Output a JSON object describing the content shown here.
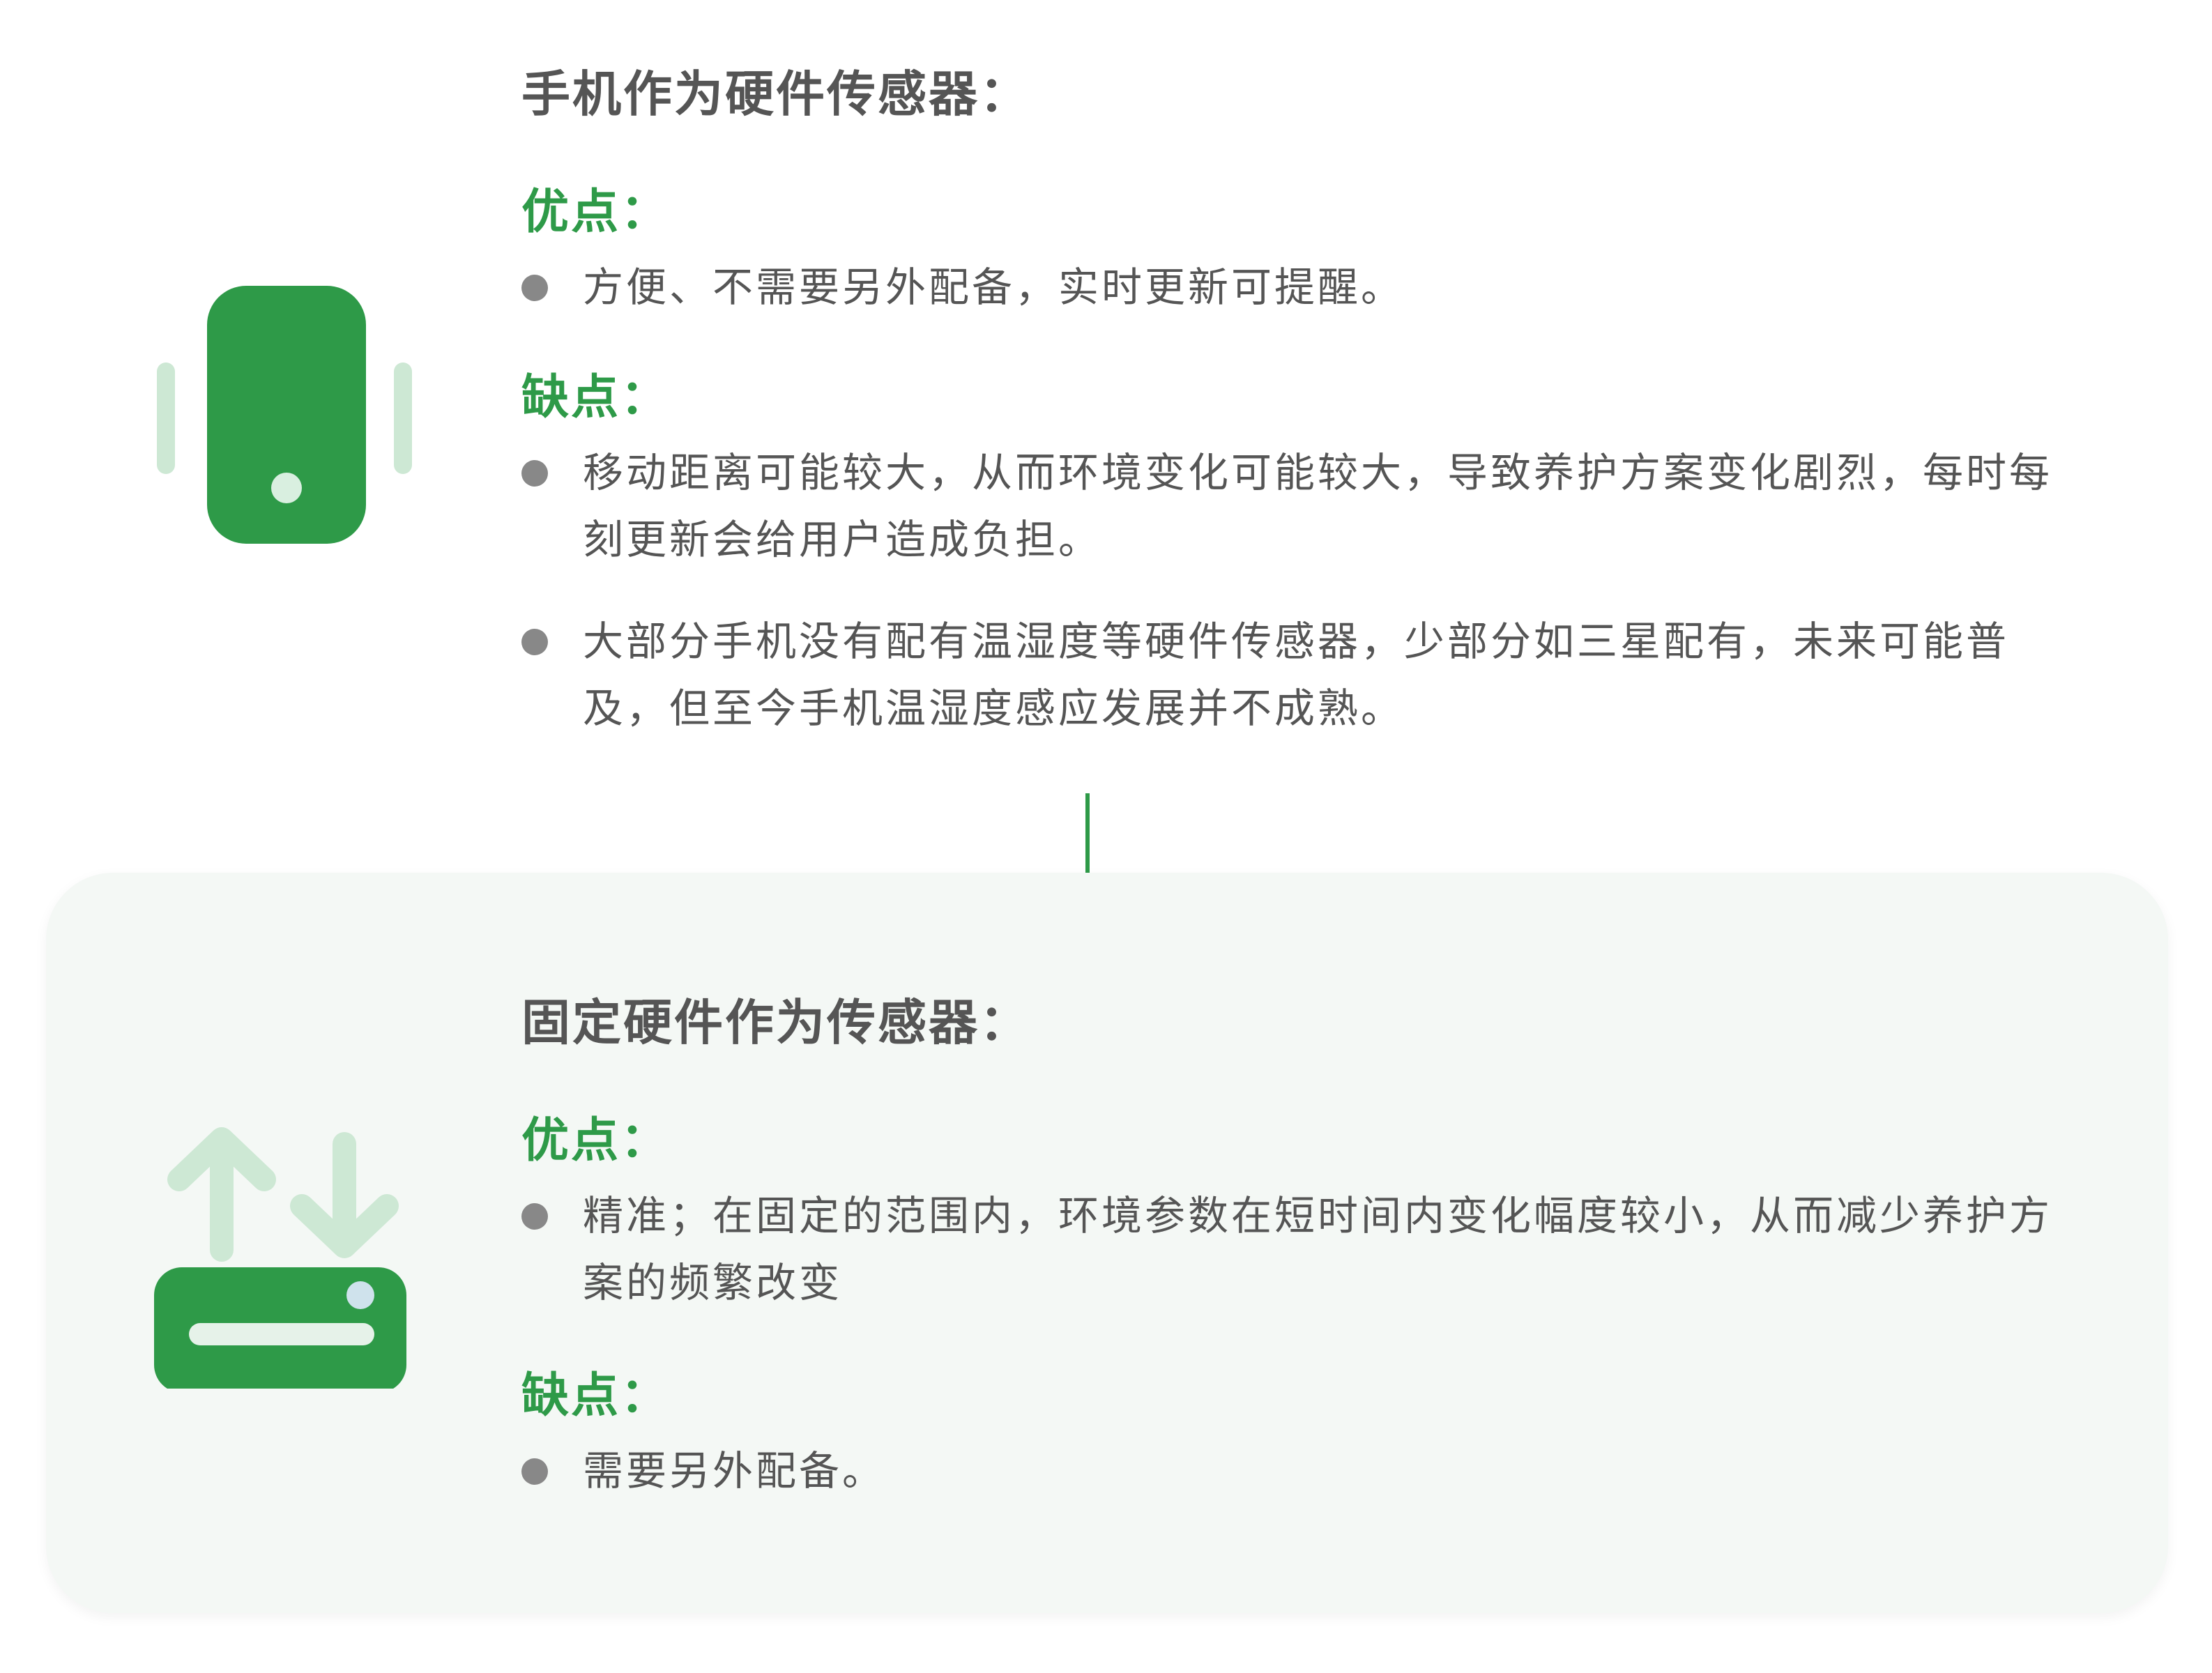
{
  "colors": {
    "accent_green": "#2e9a48",
    "light_green": "#cde8d4",
    "heading_text": "#555555",
    "bullet_dot": "#888888",
    "panel_background": "#f4f8f5"
  },
  "phone_sensor": {
    "icon": "phone-vibrate-icon",
    "title": "手机作为硬件传感器：",
    "pros_label": "优点：",
    "pros": [
      "方便、不需要另外配备，实时更新可提醒。"
    ],
    "cons_label": "缺点：",
    "cons": [
      "移动距离可能较大，从而环境变化可能较大，导致养护方案变化剧烈，每时每刻更新会给用户造成负担。",
      "大部分手机没有配有温湿度等硬件传感器，少部分如三星配有，未来可能普及，但至今手机温湿度感应发展并不成熟。"
    ]
  },
  "flow_arrow": {
    "icon": "arrow-down-icon"
  },
  "fixed_sensor": {
    "icon": "router-upload-download-icon",
    "title": "固定硬件作为传感器：",
    "pros_label": "优点：",
    "pros": [
      "精准；在固定的范围内，环境参数在短时间内变化幅度较小，从而减少养护方案的频繁改变"
    ],
    "cons_label": "缺点：",
    "cons": [
      "需要另外配备。"
    ]
  }
}
